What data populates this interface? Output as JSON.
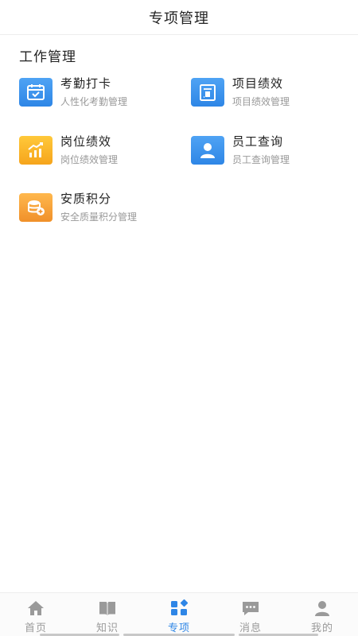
{
  "header": {
    "title": "专项管理"
  },
  "section": {
    "title": "工作管理"
  },
  "modules": [
    {
      "name": "考勤打卡",
      "desc": "人性化考勤管理",
      "icon": "attendance-calendar-icon",
      "color": "#3a94ee"
    },
    {
      "name": "项目绩效",
      "desc": "项目绩效管理",
      "icon": "project-performance-icon",
      "color": "#3a94ee"
    },
    {
      "name": "岗位绩效",
      "desc": "岗位绩效管理",
      "icon": "post-performance-chart-icon",
      "color": "#f8b328"
    },
    {
      "name": "员工查询",
      "desc": "员工查询管理",
      "icon": "employee-user-icon",
      "color": "#3a94ee"
    },
    {
      "name": "安质积分",
      "desc": "安全质量积分管理",
      "icon": "safety-points-coins-icon",
      "color": "#f49c34"
    }
  ],
  "tabs": [
    {
      "label": "首页",
      "icon": "home-icon",
      "active": false
    },
    {
      "label": "知识",
      "icon": "book-icon",
      "active": false
    },
    {
      "label": "专项",
      "icon": "apps-grid-icon",
      "active": true
    },
    {
      "label": "消息",
      "icon": "message-icon",
      "active": false
    },
    {
      "label": "我的",
      "icon": "profile-icon",
      "active": false
    }
  ],
  "colors": {
    "accent": "#2e86e6",
    "inactive": "#9a9a9a",
    "desc": "#999999"
  }
}
